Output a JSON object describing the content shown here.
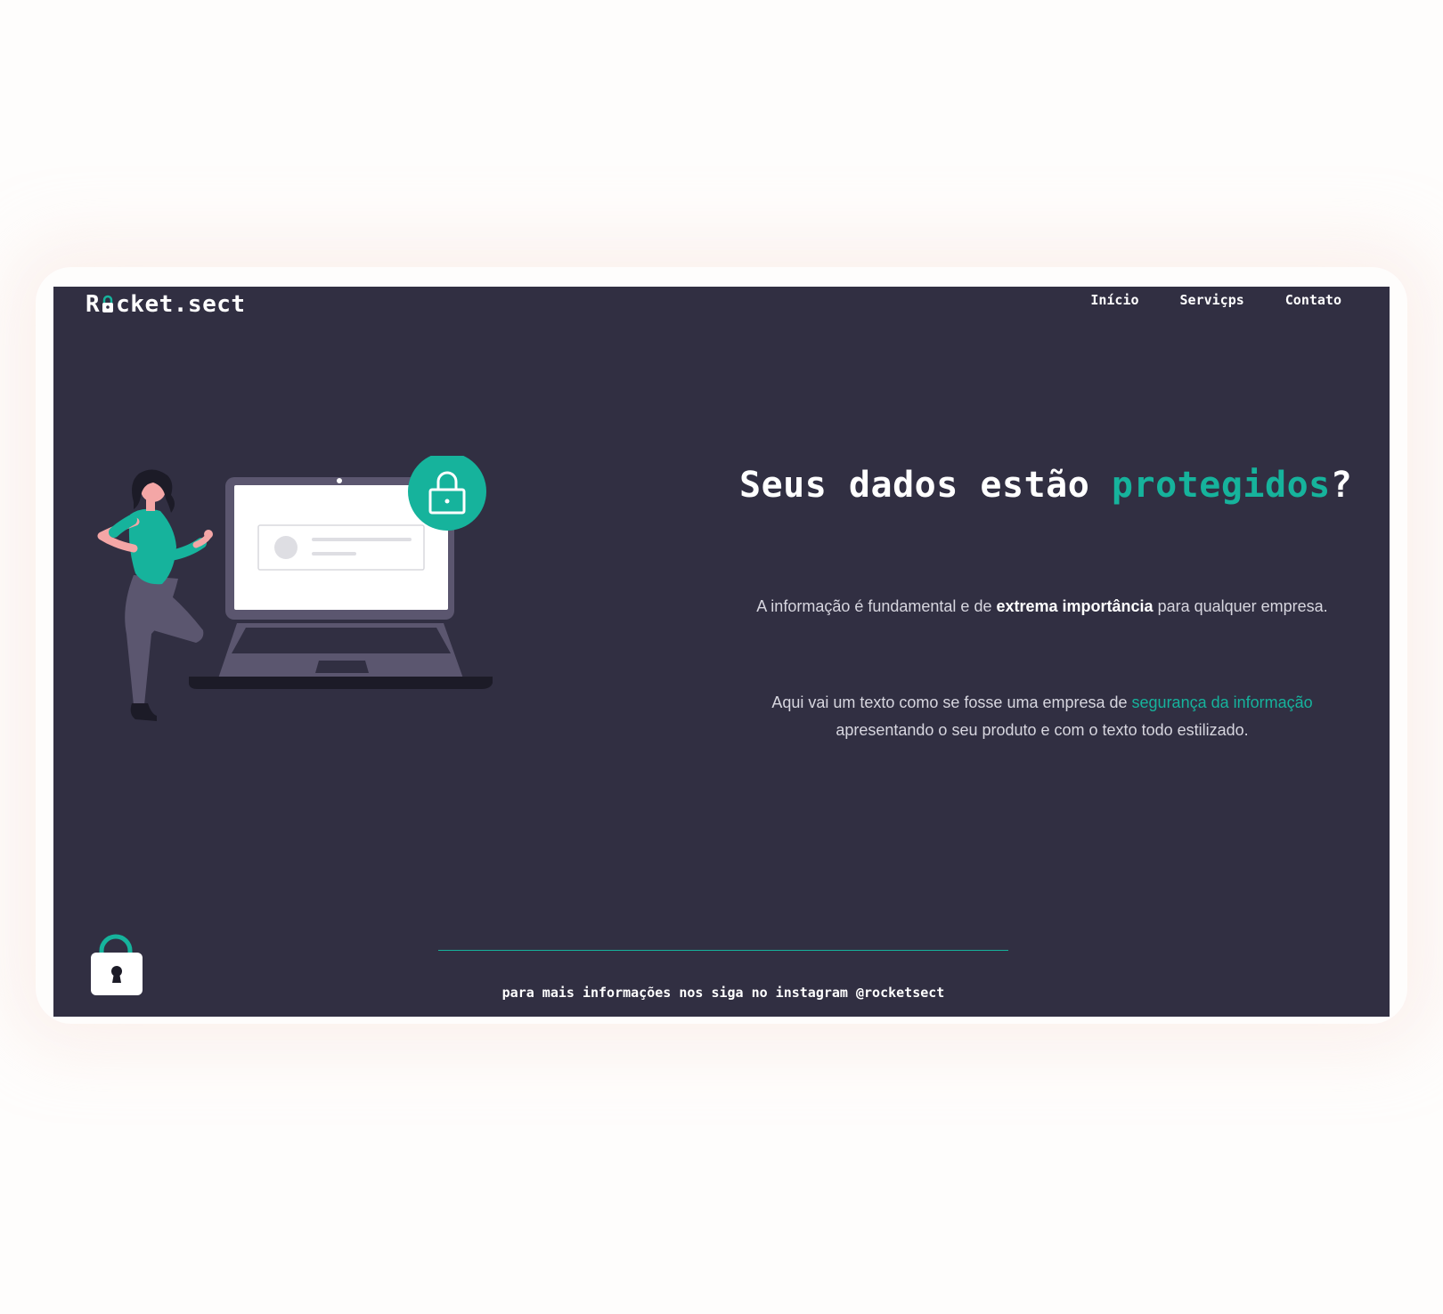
{
  "header": {
    "logo": {
      "prefix": "R",
      "suffix": "cket.sect"
    },
    "nav": [
      {
        "label": "Início"
      },
      {
        "label": "Serviçps"
      },
      {
        "label": "Contato"
      }
    ]
  },
  "hero": {
    "headline": {
      "before": "Seus dados estão ",
      "accent": "protegidos",
      "after": "?"
    },
    "paragraph1": {
      "before": "A informação é fundamental e de ",
      "bold": "extrema importância",
      "after": " para qualquer empresa."
    },
    "paragraph2": {
      "before": "Aqui vai um texto como se fosse uma empresa de ",
      "link": "segurança da informação",
      "after": " apresentando o seu produto e com o texto todo estilizado."
    }
  },
  "footer": {
    "text": "para mais informações nos siga no instagram @rocketsect"
  },
  "colors": {
    "background": "#312f42",
    "accent": "#16b39c",
    "page": "#fefdfc"
  },
  "icons": {
    "logo_o": "lock-icon",
    "illustration_badge": "lock-icon",
    "footer": "padlock-icon"
  }
}
